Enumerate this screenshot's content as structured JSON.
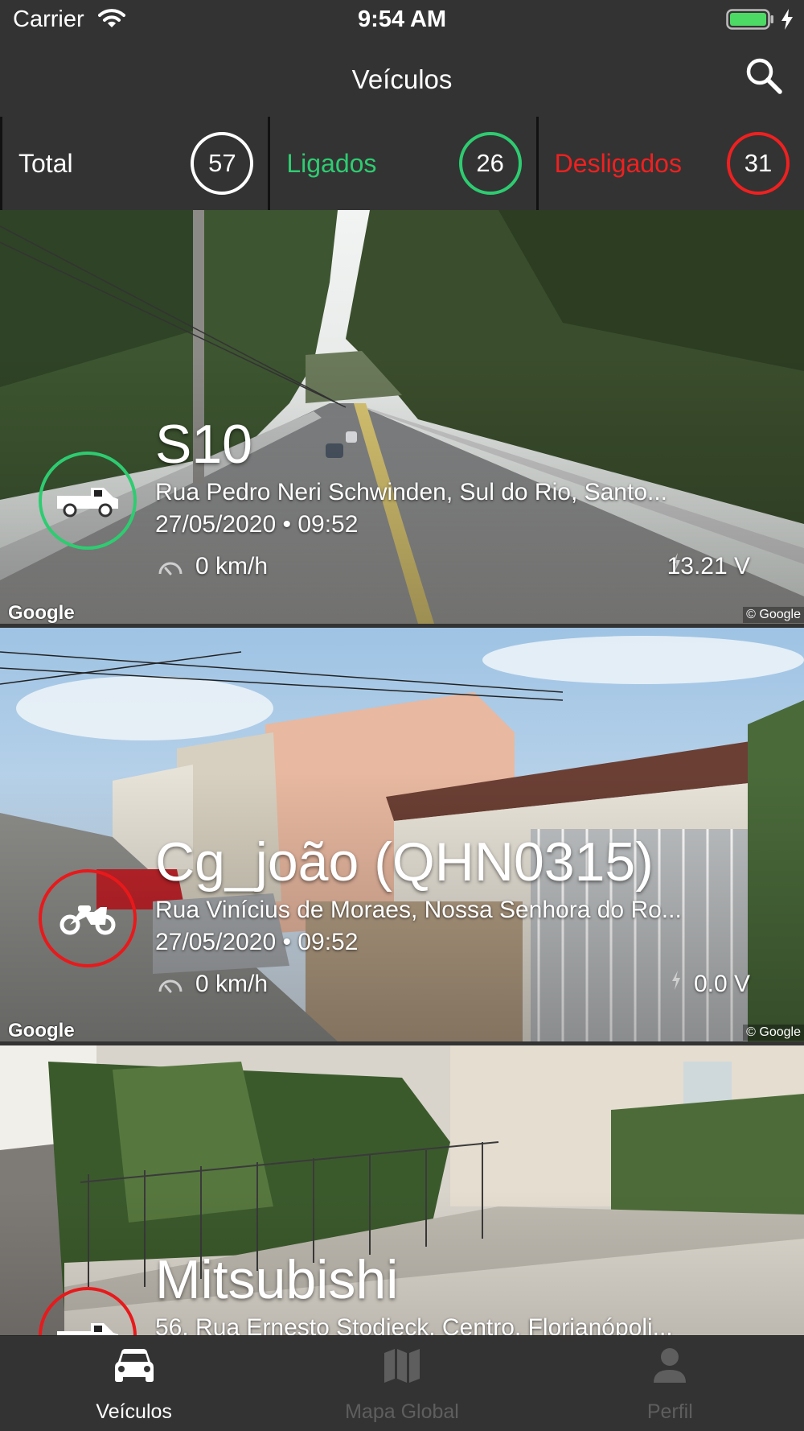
{
  "status_bar": {
    "carrier": "Carrier",
    "time": "9:54 AM",
    "icons": [
      "wifi-icon",
      "battery-icon",
      "charging-bolt-icon"
    ]
  },
  "nav": {
    "title": "Veículos",
    "search_icon": "search-icon"
  },
  "summary": {
    "total": {
      "label": "Total",
      "count": "57"
    },
    "on": {
      "label": "Ligados",
      "count": "26",
      "color": "#2ecc71"
    },
    "off": {
      "label": "Desligados",
      "count": "31",
      "color": "#f02020"
    }
  },
  "vehicles": [
    {
      "name": "S10",
      "address": "Rua Pedro Neri Schwinden, Sul do Rio, Santo...",
      "datetime": "27/05/2020 • 09:52",
      "speed": "0 km/h",
      "voltage": "13.21 V",
      "status": "on",
      "icon": "pickup-truck-icon"
    },
    {
      "name": "Cg_joão  (QHN0315)",
      "address": "Rua Vinícius de Moraes, Nossa Senhora do Ro...",
      "datetime": "27/05/2020 • 09:52",
      "speed": "0 km/h",
      "voltage": "0.0 V",
      "status": "off",
      "icon": "motorcycle-icon"
    },
    {
      "name": "Mitsubishi",
      "address": "56, Rua Ernesto Stodieck, Centro, Florianópoli...",
      "status": "off",
      "icon": "pickup-truck-icon"
    }
  ],
  "map_attribution": {
    "logo": "Google",
    "copyright": "© Google"
  },
  "tabs": [
    {
      "label": "Veículos",
      "icon": "car-icon",
      "active": true
    },
    {
      "label": "Mapa Global",
      "icon": "map-icon",
      "active": false
    },
    {
      "label": "Perfil",
      "icon": "person-icon",
      "active": false
    }
  ],
  "colors": {
    "background": "#333333",
    "on_green": "#2ecc71",
    "off_red": "#f02020"
  }
}
